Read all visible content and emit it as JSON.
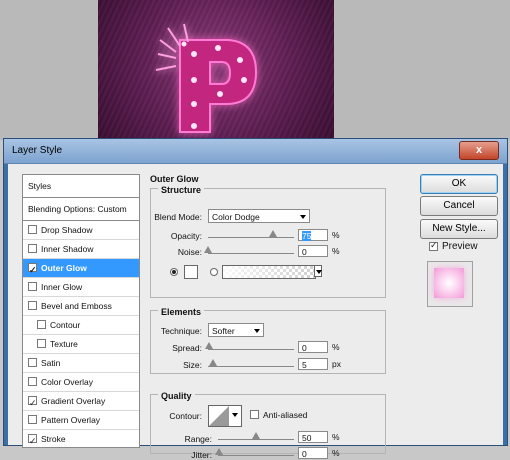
{
  "window": {
    "title": "Layer Style",
    "close_glyph": "x"
  },
  "styles_list": [
    {
      "label": "Styles",
      "header": true
    },
    {
      "label": "Blending Options: Custom",
      "header": true
    },
    {
      "label": "Drop Shadow",
      "checked": false
    },
    {
      "label": "Inner Shadow",
      "checked": false
    },
    {
      "label": "Outer Glow",
      "checked": true,
      "selected": true
    },
    {
      "label": "Inner Glow",
      "checked": false
    },
    {
      "label": "Bevel and Emboss",
      "checked": false
    },
    {
      "label": "Contour",
      "checked": false,
      "indent": true
    },
    {
      "label": "Texture",
      "checked": false,
      "indent": true
    },
    {
      "label": "Satin",
      "checked": false
    },
    {
      "label": "Color Overlay",
      "checked": false
    },
    {
      "label": "Gradient Overlay",
      "checked": true
    },
    {
      "label": "Pattern Overlay",
      "checked": false
    },
    {
      "label": "Stroke",
      "checked": true
    }
  ],
  "panel": {
    "title": "Outer Glow",
    "structure": {
      "title": "Structure",
      "blend_mode_label": "Blend Mode:",
      "blend_mode_value": "Color Dodge",
      "opacity_label": "Opacity:",
      "opacity_value": "75",
      "opacity_percent": 75,
      "noise_label": "Noise:",
      "noise_value": "0",
      "noise_percent": 0,
      "glow_color": "#ffffff",
      "percent_unit": "%"
    },
    "elements": {
      "title": "Elements",
      "technique_label": "Technique:",
      "technique_value": "Softer",
      "spread_label": "Spread:",
      "spread_value": "0",
      "spread_unit": "%",
      "size_label": "Size:",
      "size_value": "5",
      "size_unit": "px"
    },
    "quality": {
      "title": "Quality",
      "contour_label": "Contour:",
      "anti_aliased_label": "Anti-aliased",
      "anti_aliased_checked": false,
      "range_label": "Range:",
      "range_value": "50",
      "range_percent": 50,
      "range_unit": "%",
      "jitter_label": "Jitter:",
      "jitter_value": "0",
      "jitter_unit": "%"
    }
  },
  "buttons": {
    "ok": "OK",
    "cancel": "Cancel",
    "new_style": "New Style...",
    "preview_label": "Preview",
    "preview_checked": true
  },
  "colors": {
    "accent": "#3399ff",
    "art_background": "#5e1e52",
    "preview_glow": "#f29ad8"
  }
}
